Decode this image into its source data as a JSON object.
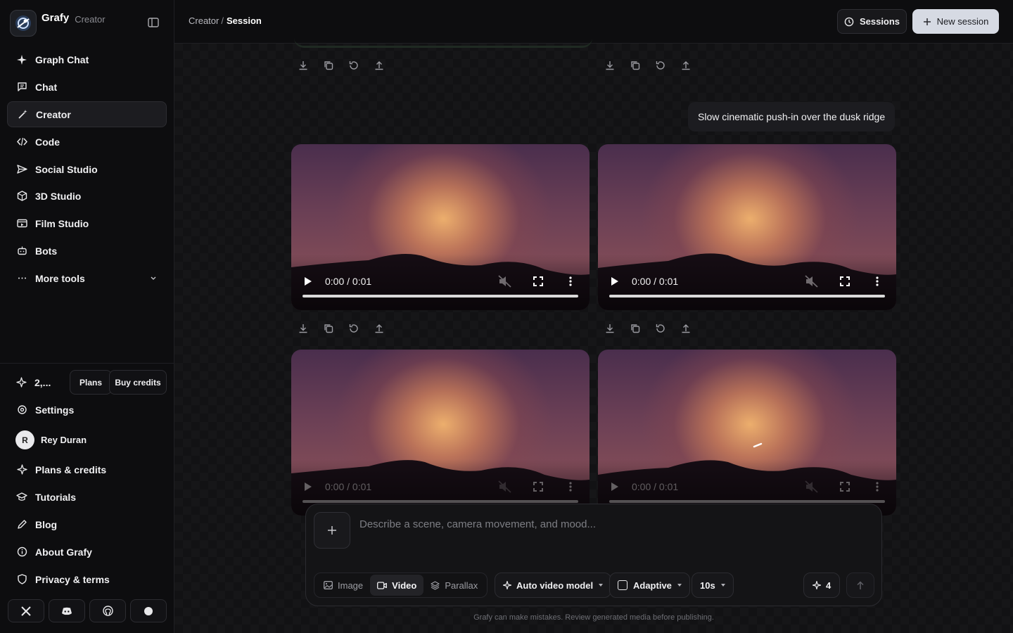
{
  "brand": {
    "name": "Grafy",
    "subtitle": "Creator"
  },
  "sidebar": {
    "items": [
      {
        "label": "Graph Chat",
        "icon": "sparkle-icon"
      },
      {
        "label": "Chat",
        "icon": "message-square-icon"
      },
      {
        "label": "Creator",
        "icon": "magic-wand-icon",
        "active": true
      },
      {
        "label": "Code",
        "icon": "code-icon"
      },
      {
        "label": "Social Studio",
        "icon": "send-icon"
      },
      {
        "label": "3D Studio",
        "icon": "cube-icon"
      },
      {
        "label": "Film Studio",
        "icon": "film-icon"
      },
      {
        "label": "Bots",
        "icon": "bot-icon"
      },
      {
        "label": "More tools",
        "icon": "ellipsis-icon"
      }
    ],
    "credits": {
      "amount": "2,...",
      "plans_label": "Plans",
      "buy_label": "Buy credits"
    },
    "settings_label": "Settings",
    "user": {
      "initial": "R",
      "name": "Rey Duran"
    },
    "footer_links": [
      {
        "label": "Plans & credits",
        "icon": "sparkle-icon"
      },
      {
        "label": "Tutorials",
        "icon": "graduation-cap-icon"
      },
      {
        "label": "Blog",
        "icon": "pen-icon"
      },
      {
        "label": "About Grafy",
        "icon": "info-icon"
      },
      {
        "label": "Privacy & terms",
        "icon": "shield-icon"
      }
    ],
    "social": [
      "x-icon",
      "discord-icon",
      "github-icon",
      "circle-icon"
    ]
  },
  "header": {
    "breadcrumb_parent": "Creator",
    "breadcrumb_sep": "/",
    "breadcrumb_current": "Session",
    "sessions_label": "Sessions",
    "new_session_label": "New session"
  },
  "chat": {
    "user_prompt": "Slow cinematic push-in over the dusk ridge",
    "videos": [
      {
        "time": "0:00 / 0:01"
      },
      {
        "time": "0:00 / 0:01"
      },
      {
        "time": "0:00 / 0:01"
      },
      {
        "time": "0:00 / 0:01"
      }
    ]
  },
  "composer": {
    "placeholder": "Describe a scene, camera movement, and mood...",
    "modes": [
      {
        "label": "Image",
        "active": false
      },
      {
        "label": "Video",
        "active": true
      },
      {
        "label": "Parallax",
        "active": false
      }
    ],
    "model_label": "Auto video model",
    "aspect_label": "Adaptive",
    "duration_label": "10s",
    "count_label": "4"
  },
  "disclaimer": "Grafy can make mistakes. Review generated media before publishing.",
  "colors": {
    "accent": "#d6dae3",
    "background": "#0b0b0c",
    "panel": "#141416"
  }
}
